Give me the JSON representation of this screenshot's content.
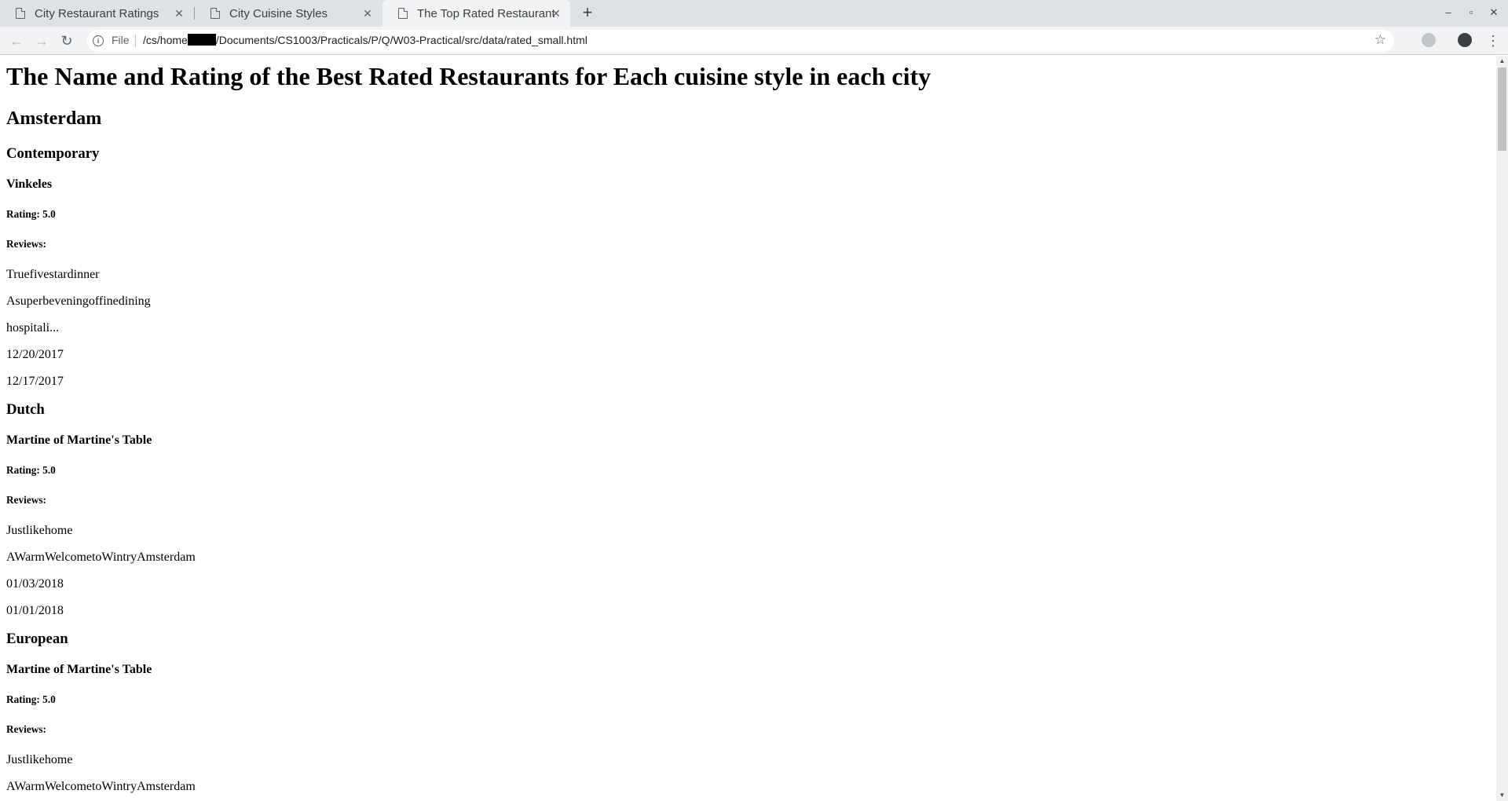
{
  "browser": {
    "tabs": [
      {
        "title": "City Restaurant Ratings",
        "close": "✕"
      },
      {
        "title": "City Cuisine Styles",
        "close": "✕"
      },
      {
        "title": "The Top Rated Restaurants",
        "close": "✕"
      }
    ],
    "new_tab": "+",
    "window_controls": {
      "minimize": "–",
      "maximize": "▫",
      "close": "✕"
    },
    "nav": {
      "back": "←",
      "forward": "→",
      "reload": "↻"
    },
    "address": {
      "scheme": "File",
      "url_prefix": "/cs/home",
      "url_suffix": "/Documents/CS1003/Practicals/P/Q/W03-Practical/src/data/rated_small.html"
    },
    "icons": {
      "star": "☆",
      "menu": "⋮",
      "info": "i"
    }
  },
  "page": {
    "title": "The Name and Rating of the Best Rated Restaurants for Each cuisine style in each city",
    "city": "Amsterdam",
    "sections": [
      {
        "cuisine": "Contemporary",
        "restaurant": "Vinkeles",
        "rating": "Rating: 5.0",
        "reviews_label": "Reviews:",
        "reviews": [
          "Truefivestardinner",
          "Asuperbeveningoffinedining",
          "hospitali...",
          "12/20/2017",
          "12/17/2017"
        ]
      },
      {
        "cuisine": "Dutch",
        "restaurant": "Martine of Martine's Table",
        "rating": "Rating: 5.0",
        "reviews_label": "Reviews:",
        "reviews": [
          "Justlikehome",
          "AWarmWelcometoWintryAmsterdam",
          "01/03/2018",
          "01/01/2018"
        ]
      },
      {
        "cuisine": "European",
        "restaurant": "Martine of Martine's Table",
        "rating": "Rating: 5.0",
        "reviews_label": "Reviews:",
        "reviews": [
          "Justlikehome",
          "AWarmWelcometoWintryAmsterdam"
        ]
      }
    ]
  },
  "scrollbar": {
    "up": "▲",
    "down": "▼"
  }
}
